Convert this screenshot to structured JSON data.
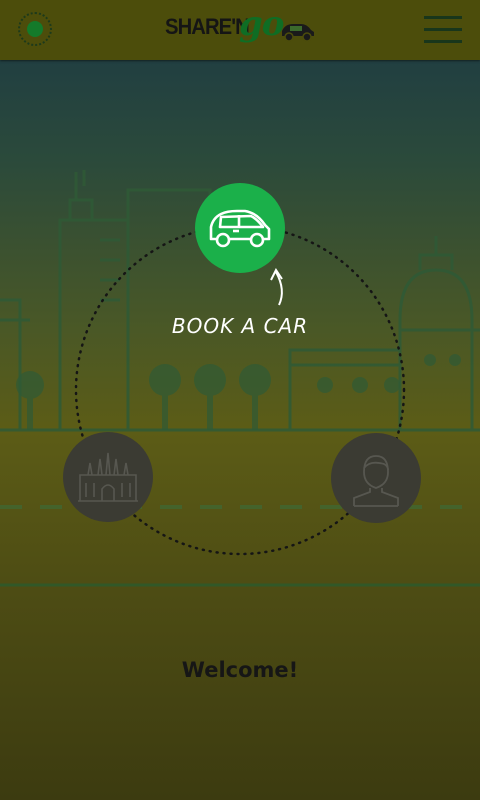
{
  "app": {
    "logo_share": "SHARE'N",
    "logo_go": "go"
  },
  "topbar": {
    "location_icon": "location-target-icon",
    "menu_icon": "hamburger-menu-icon"
  },
  "main": {
    "book_label": "BOOK A CAR",
    "book_icon": "car-icon",
    "left_icon": "cathedral-icon",
    "right_icon": "user-profile-icon",
    "welcome": "Welcome!"
  },
  "colors": {
    "accent_green": "#1bb04a",
    "topbar": "#4c4d0b",
    "logo_green": "#0f6d24"
  }
}
